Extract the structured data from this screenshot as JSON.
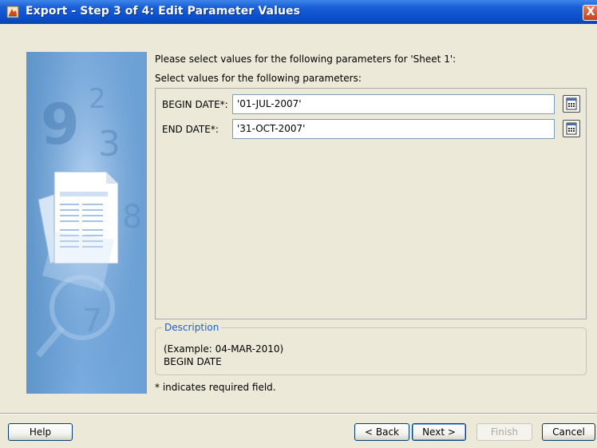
{
  "window": {
    "title": "Export - Step 3 of 4: Edit Parameter Values",
    "close_glyph": "X"
  },
  "content": {
    "intro": "Please select values for the following parameters for 'Sheet 1':",
    "subintro": "Select values for the following parameters:"
  },
  "params": [
    {
      "label": "BEGIN DATE*:",
      "value": "'01-JUL-2007'"
    },
    {
      "label": "END DATE*:",
      "value": "'31-OCT-2007'"
    }
  ],
  "description": {
    "legend": "Description",
    "line1": "(Example: 04-MAR-2010)",
    "line2": "BEGIN DATE"
  },
  "required_note": "* indicates required field.",
  "buttons": {
    "help": "Help",
    "back": "< Back",
    "next": "Next >",
    "finish": "Finish",
    "cancel": "Cancel"
  },
  "colors": {
    "titlebar": "#0b4fcf",
    "legend_text": "#1a5fcf",
    "dialog_bg": "#ece9d8"
  },
  "icons": {
    "app": "export-wizard-icon",
    "calendar": "calendar-icon",
    "close": "close-icon"
  }
}
